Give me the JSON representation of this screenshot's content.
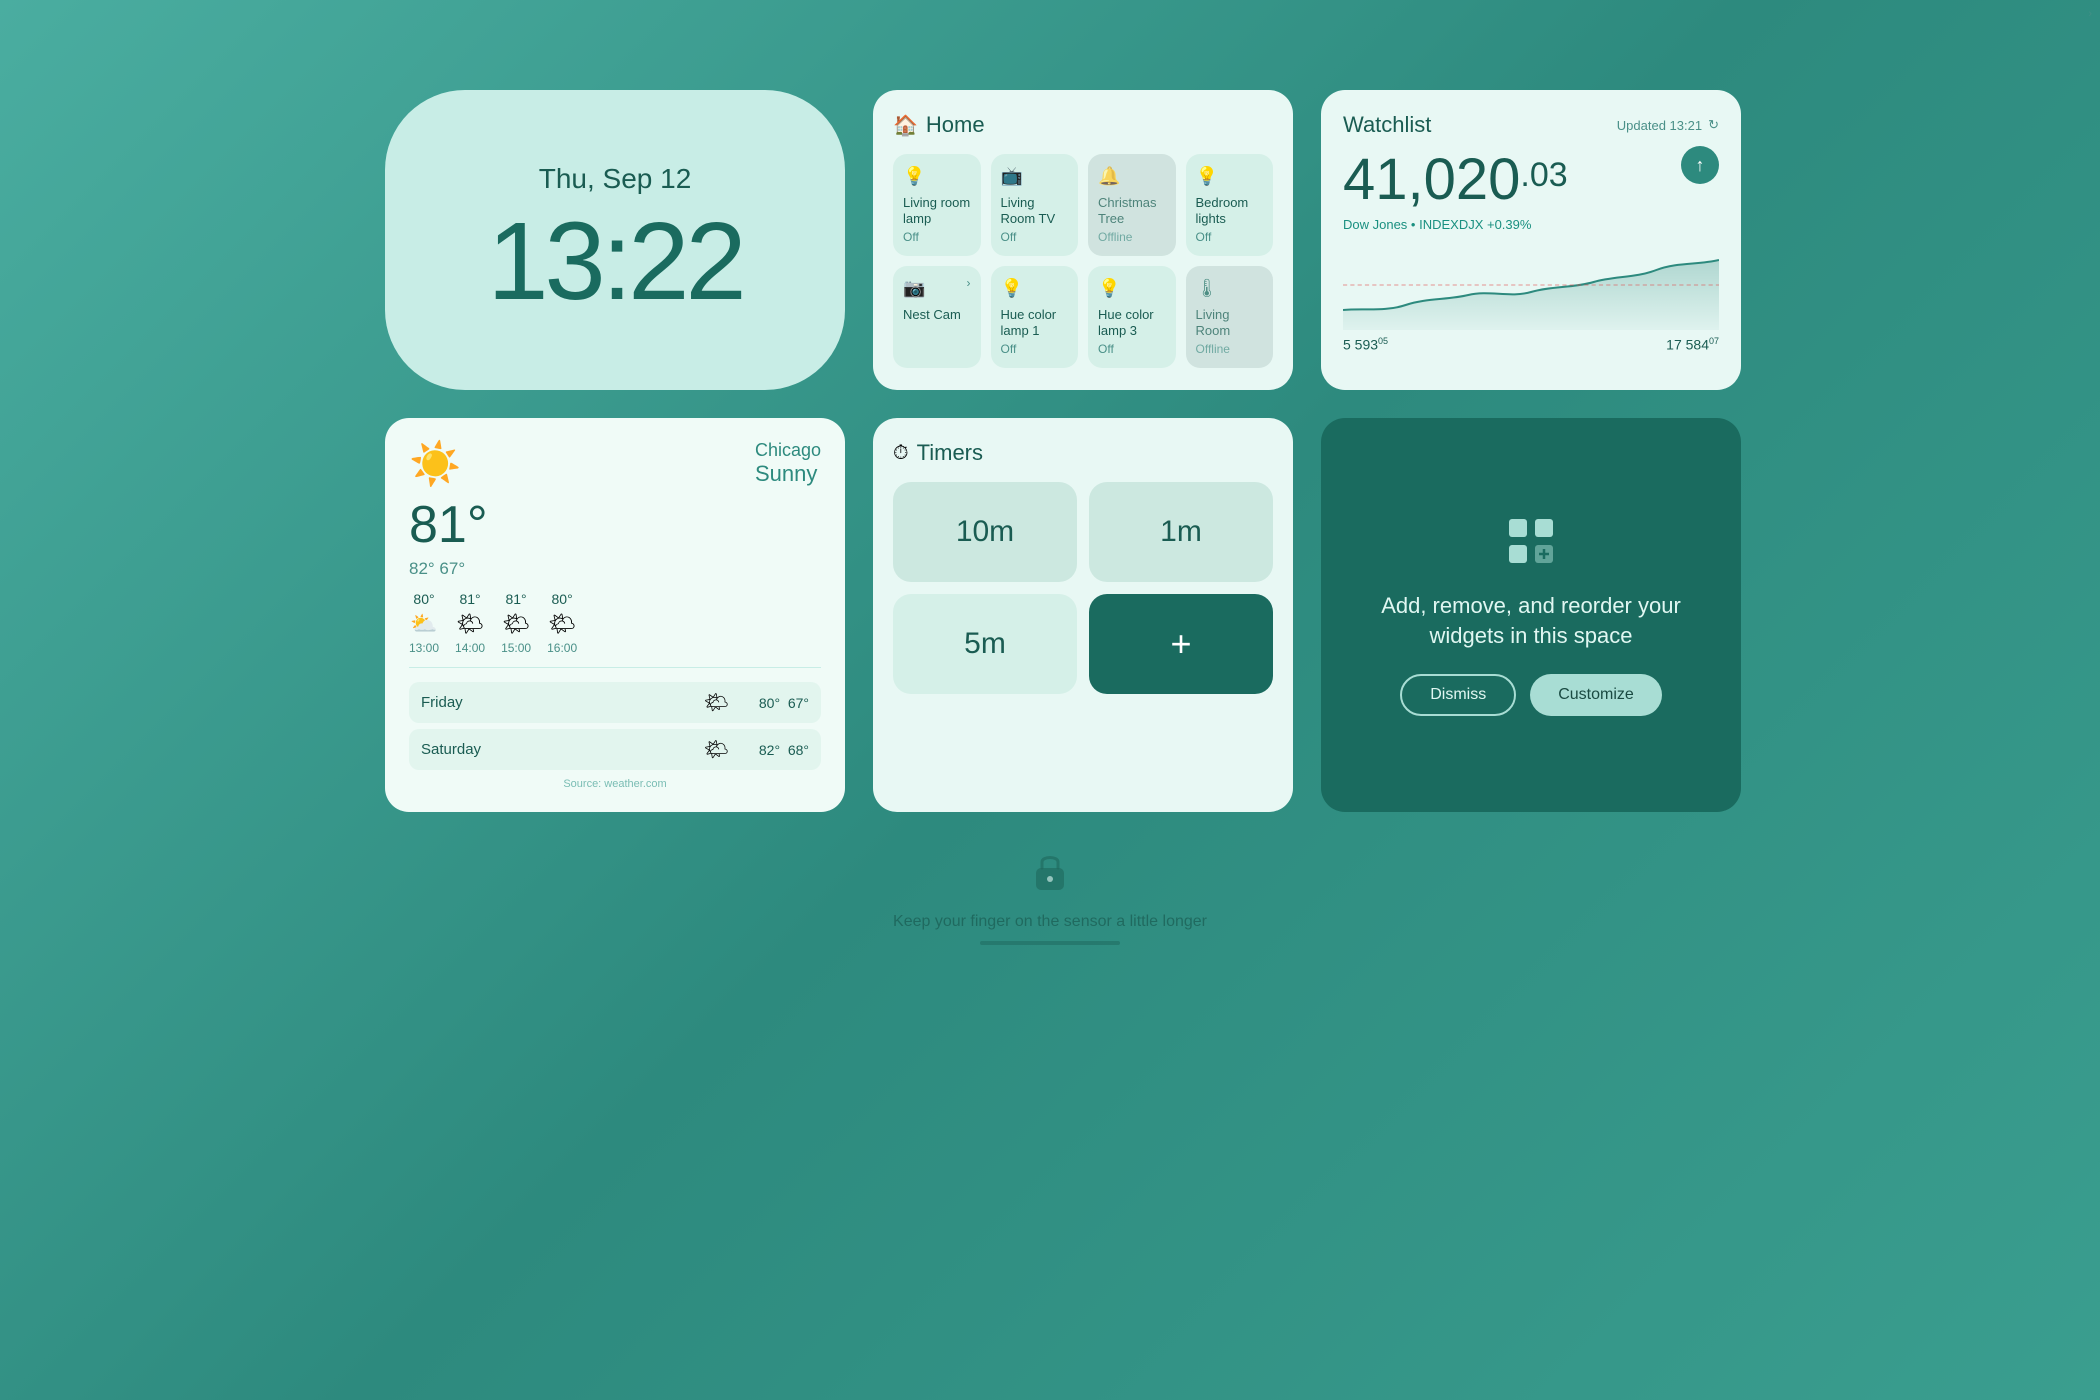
{
  "clock": {
    "date": "Thu, Sep 12",
    "time": "13:22"
  },
  "home": {
    "title": "Home",
    "header_icon": "🏠",
    "devices": [
      {
        "name": "Living room lamp",
        "status": "Off",
        "icon": "💡",
        "offline": false
      },
      {
        "name": "Living Room TV",
        "status": "Off",
        "icon": "📺",
        "offline": false
      },
      {
        "name": "Christmas Tree",
        "status": "Offline",
        "icon": "🔔",
        "offline": true
      },
      {
        "name": "Bedroom lights",
        "status": "Off",
        "icon": "💡",
        "offline": false
      },
      {
        "name": "Nest Cam",
        "status": "",
        "icon": "📷",
        "offline": false,
        "wide": true
      },
      {
        "name": "Hue color lamp 1",
        "status": "Off",
        "icon": "💡",
        "offline": false
      },
      {
        "name": "Hue color lamp 3",
        "status": "Off",
        "icon": "💡",
        "offline": false
      },
      {
        "name": "Living Room",
        "status": "Offline",
        "icon": "🌡",
        "offline": true
      }
    ]
  },
  "watchlist": {
    "title": "Watchlist",
    "updated_label": "Updated 13:21",
    "value_main": "41,020",
    "value_decimal": ".03",
    "arrow_icon": "↑",
    "index_label": "Dow Jones • INDEXDJX +0.39%",
    "footer": [
      {
        "value": "5 593",
        "label": "05"
      },
      {
        "value": "17 584",
        "label": "07"
      }
    ]
  },
  "weather": {
    "location": "Chicago",
    "condition": "Sunny",
    "temp_main": "81°",
    "temp_range": "82° 67°",
    "sun_icon": "☀️",
    "hourly": [
      {
        "temp": "80°",
        "icon": "⛅",
        "time": "13:00"
      },
      {
        "temp": "81°",
        "icon": "🌤",
        "time": "14:00"
      },
      {
        "temp": "81°",
        "icon": "🌤",
        "time": "15:00"
      },
      {
        "temp": "80°",
        "icon": "🌤",
        "time": "16:00"
      }
    ],
    "daily": [
      {
        "day": "Friday",
        "icon": "🌤",
        "high": "80°",
        "low": "67°"
      },
      {
        "day": "Saturday",
        "icon": "🌤",
        "high": "82°",
        "low": "68°"
      }
    ],
    "source": "Source: weather.com"
  },
  "timers": {
    "title": "Timers",
    "header_icon": "⏱",
    "items": [
      "10m",
      "1m",
      "5m"
    ],
    "add_label": "+"
  },
  "promo": {
    "icon": "⊞",
    "text": "Add, remove, and reorder your widgets in this space",
    "dismiss_label": "Dismiss",
    "customize_label": "Customize"
  },
  "lock": {
    "hint": "Keep your finger on the sensor a little longer"
  }
}
